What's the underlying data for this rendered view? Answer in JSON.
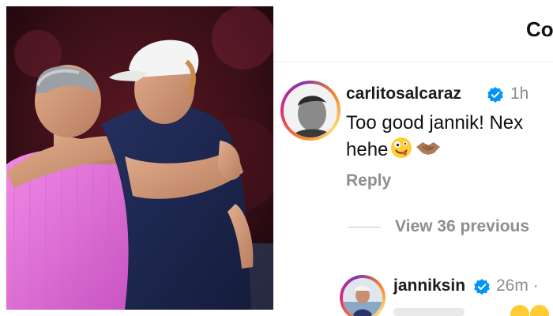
{
  "panel": {
    "title": "Co"
  },
  "comments": [
    {
      "username": "carlitosalcaraz",
      "verified": true,
      "time": "1h",
      "text_line1": "Too good jannik! Nex",
      "text_line2": "hehe",
      "emojis": [
        "zany-face-emoji",
        "handshake-emoji"
      ],
      "reply_label": "Reply"
    },
    {
      "username": "janniksin",
      "verified": true,
      "time": "26m ·"
    }
  ],
  "view_previous_label": "View 36 previous",
  "colors": {
    "verified_blue": "#0095f6",
    "muted_text": "#8e8e8e",
    "jersey_pink": "#e56fd6",
    "jersey_navy": "#1b2550"
  }
}
